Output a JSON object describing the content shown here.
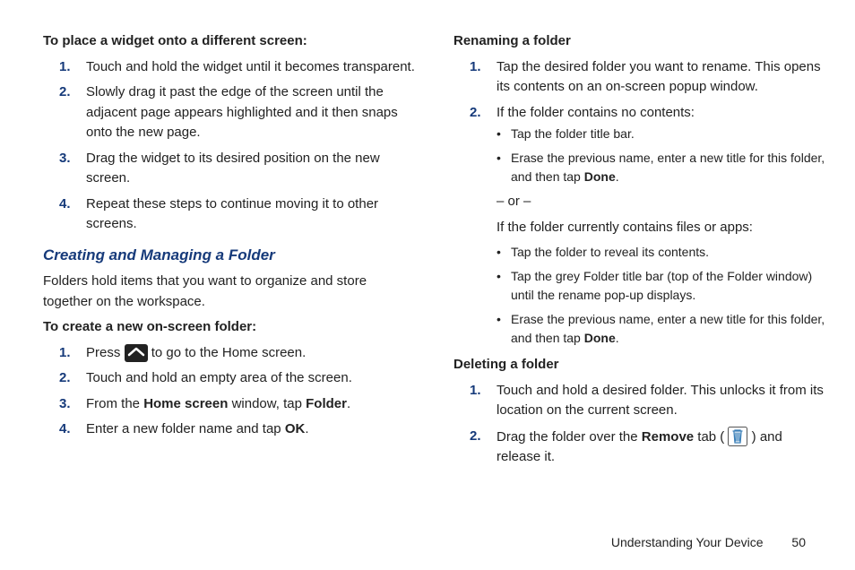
{
  "left": {
    "h1": "To place a widget onto a different screen:",
    "steps1": [
      "Touch and hold the widget until it becomes transparent.",
      "Slowly drag it past the edge of the screen until the adjacent page appears highlighted and it then snaps onto the new page.",
      "Drag the widget to its desired position on the new screen.",
      "Repeat these steps to continue moving it to other screens."
    ],
    "section": "Creating and Managing a Folder",
    "section_intro": "Folders hold items that you want to organize and store together on the workspace.",
    "h2": "To create a new on-screen folder:",
    "step2_1a": "Press ",
    "step2_1b": " to go to the Home screen.",
    "step2_2": "Touch and hold an empty area of the screen.",
    "step2_3a": "From the ",
    "step2_3b": "Home screen",
    "step2_3c": " window, tap ",
    "step2_3d": "Folder",
    "step2_3e": ".",
    "step2_4a": "Enter a new folder name and tap ",
    "step2_4b": "OK",
    "step2_4c": "."
  },
  "right": {
    "h1": "Renaming a folder",
    "r1": "Tap the desired folder you want to rename. This opens its contents on an on-screen popup window.",
    "r2": "If the folder contains no contents:",
    "b1": "Tap the folder title bar.",
    "b2a": "Erase the previous name, enter a new title for this folder, and then tap ",
    "b2b": "Done",
    "b2c": ".",
    "or": "– or –",
    "r3": "If the folder currently contains files or apps:",
    "b3": "Tap the folder to reveal its contents.",
    "b4": "Tap the grey Folder title bar (top of the Folder window) until the rename pop-up displays.",
    "b5a": "Erase the previous name, enter a new title for this folder, and then tap ",
    "b5b": "Done",
    "b5c": ".",
    "h2": "Deleting a folder",
    "d1": "Touch and hold a desired folder. This unlocks it from its location on the current screen.",
    "d2a": "Drag the folder over the ",
    "d2b": "Remove",
    "d2c": " tab ( ",
    "d2d": " ) and release it."
  },
  "footer": {
    "section": "Understanding Your Device",
    "page": "50"
  }
}
